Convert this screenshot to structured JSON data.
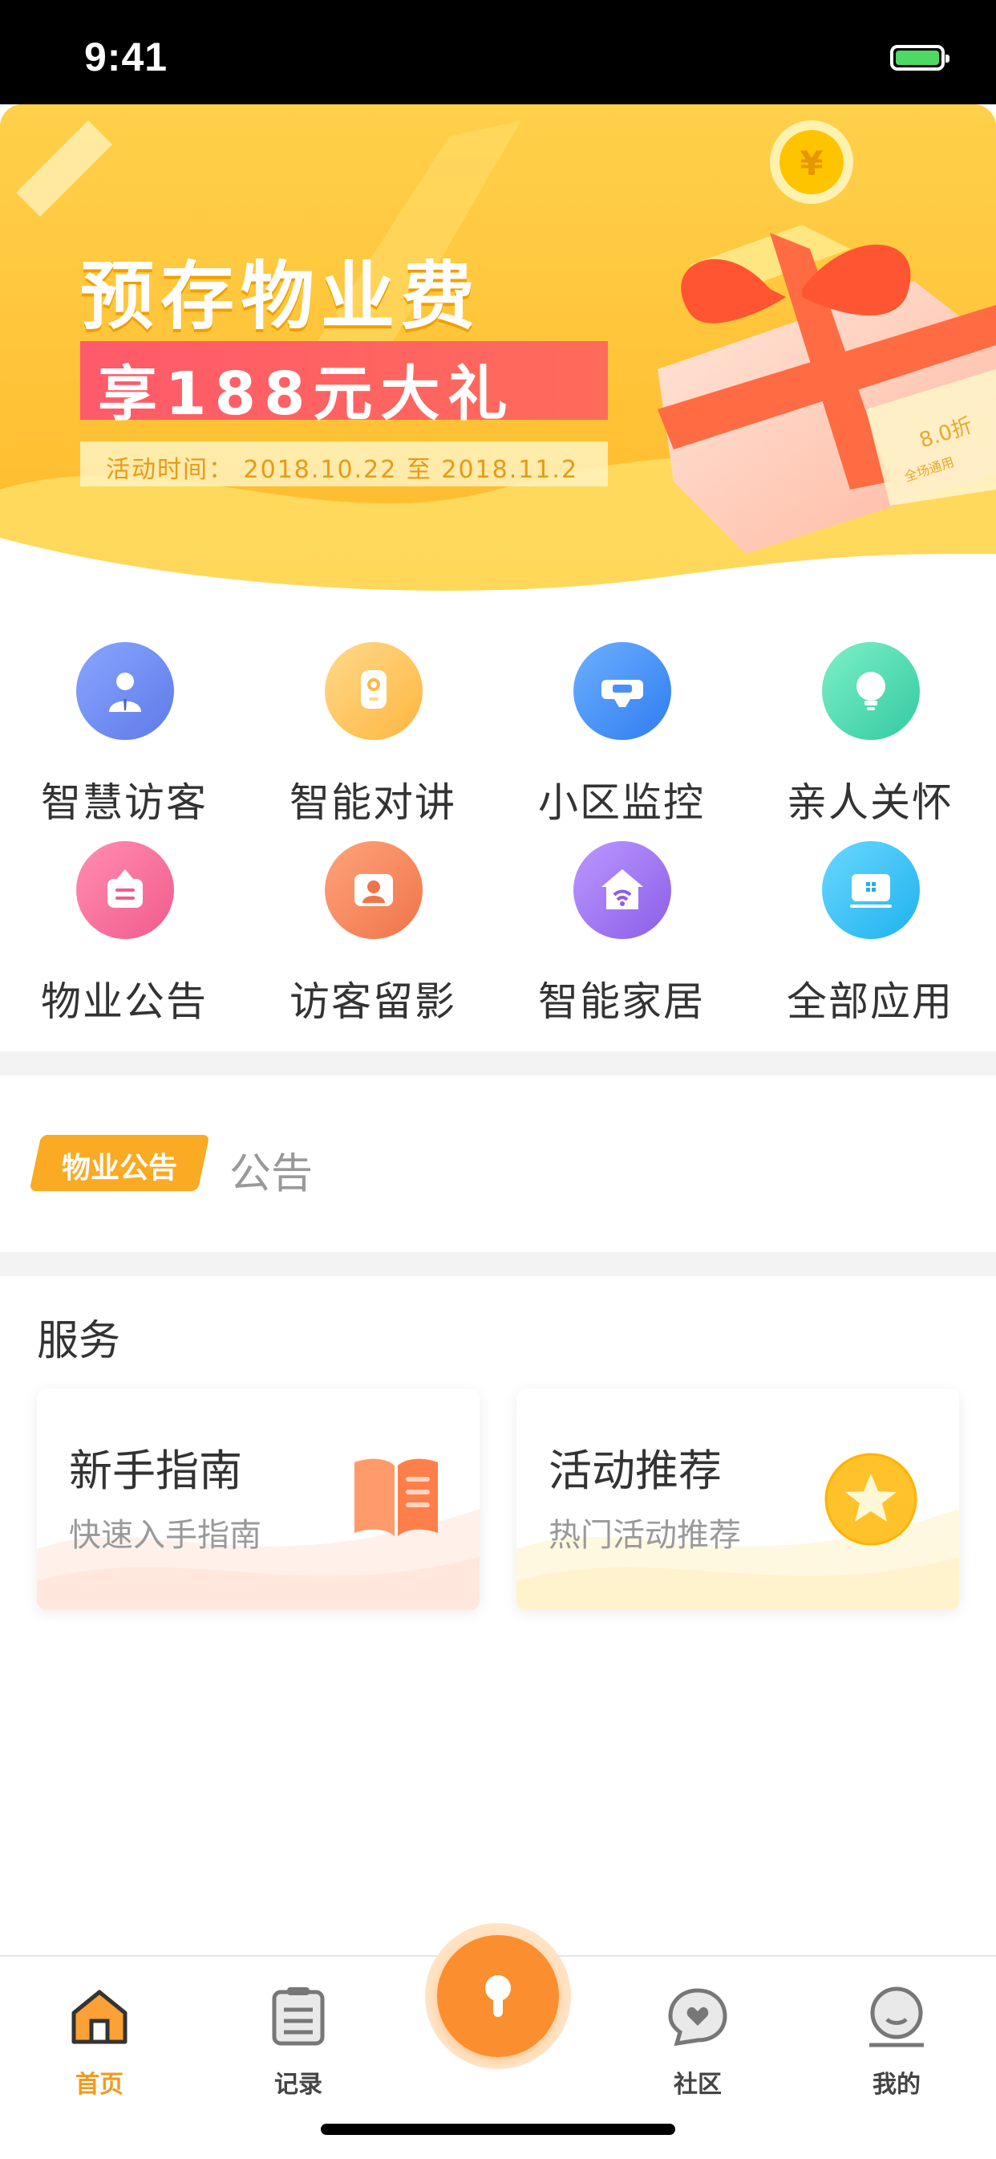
{
  "status_bar": {
    "time": "9:41",
    "battery_icon": "battery-charging-icon"
  },
  "banner": {
    "title": "预存物业费",
    "subtitle": "享188元大礼",
    "date_text": "活动时间： 2018.10.22 至 2018.11.2",
    "coupon_text": "8.0折",
    "coupon_sub": "全场通用",
    "coin_symbol": "¥"
  },
  "apps": [
    {
      "label": "智慧访客",
      "icon": "visitor-icon",
      "color": "#6f8ff5"
    },
    {
      "label": "智能对讲",
      "icon": "intercom-icon",
      "color": "#ffc259"
    },
    {
      "label": "小区监控",
      "icon": "camera-icon",
      "color": "#4a8ff6"
    },
    {
      "label": "亲人关怀",
      "icon": "lightbulb-icon",
      "color": "#4fd7b5"
    },
    {
      "label": "物业公告",
      "icon": "notice-icon",
      "color": "#f86f9c"
    },
    {
      "label": "访客留影",
      "icon": "photo-icon",
      "color": "#f98a64"
    },
    {
      "label": "智能家居",
      "icon": "smart-home-icon",
      "color": "#a27bf0"
    },
    {
      "label": "全部应用",
      "icon": "all-apps-icon",
      "color": "#36c3f5"
    }
  ],
  "notice": {
    "tag": "物业公告",
    "text": "公告"
  },
  "services": {
    "title": "服务",
    "cards": [
      {
        "title": "新手指南",
        "subtitle": "快速入手指南",
        "icon": "book-icon"
      },
      {
        "title": "活动推荐",
        "subtitle": "热门活动推荐",
        "icon": "star-icon"
      }
    ]
  },
  "tabbar": {
    "items": [
      {
        "label": "首页",
        "icon": "home-icon",
        "active": true
      },
      {
        "label": "记录",
        "icon": "records-icon",
        "active": false
      },
      {
        "label": "社区",
        "icon": "community-icon",
        "active": false
      },
      {
        "label": "我的",
        "icon": "profile-icon",
        "active": false
      }
    ],
    "center_icon": "key-icon"
  },
  "colors": {
    "accent": "#fb8f2f",
    "tag": "#fbaa23",
    "banner": "#ffc83a"
  }
}
